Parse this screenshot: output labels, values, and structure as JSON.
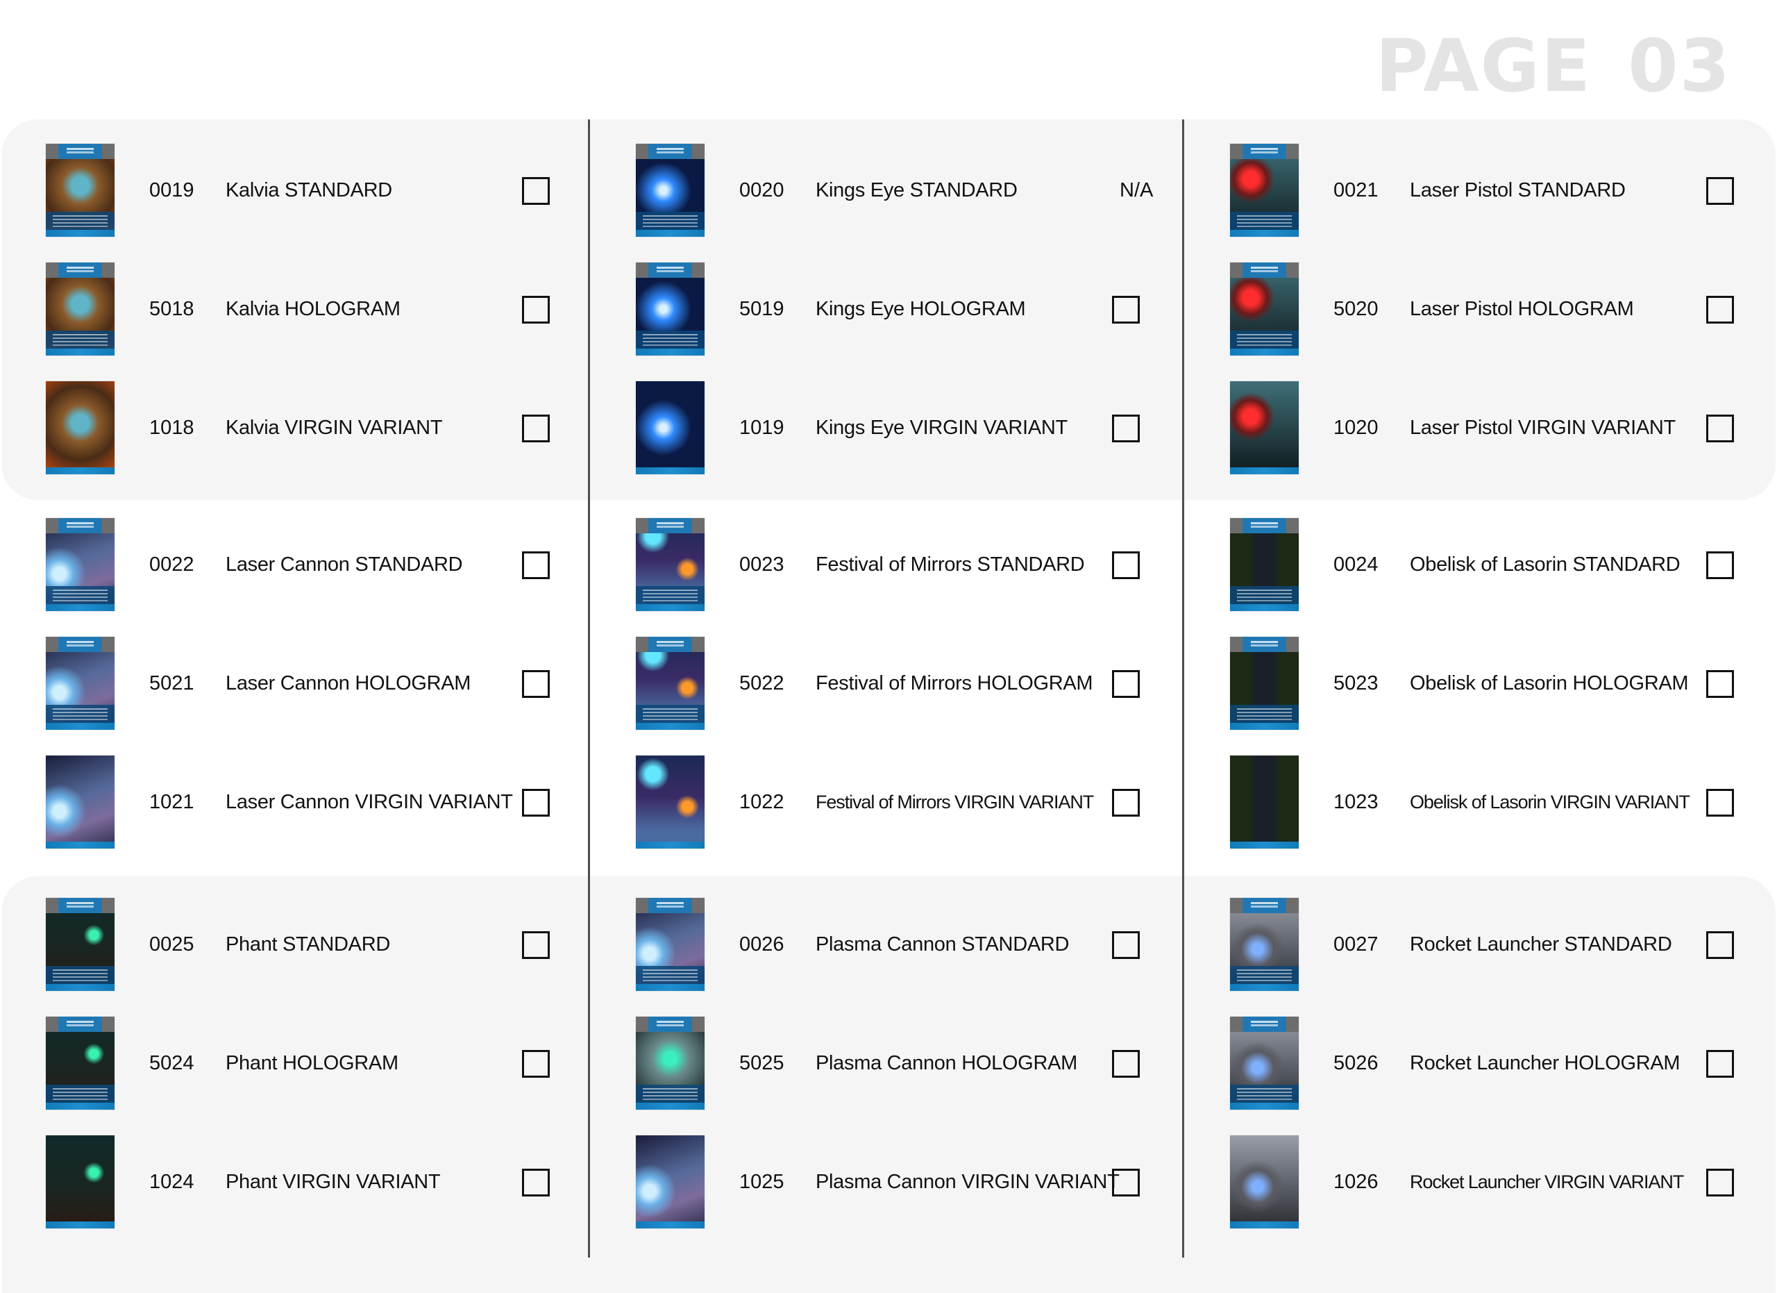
{
  "page": {
    "title": "PAGE 03"
  },
  "colors": {
    "title": "#e4e4e4",
    "band_shaded": "#f5f5f5",
    "divider": "#4d4d4d",
    "card_blue": "#1f78b4"
  },
  "groups": [
    {
      "columns": [
        {
          "entries": [
            {
              "code": "0019",
              "name": "Kalvia STANDARD",
              "status": "checkbox",
              "checked": false,
              "art": "kalvia"
            },
            {
              "code": "5018",
              "name": "Kalvia HOLOGRAM",
              "status": "checkbox",
              "checked": false,
              "art": "kalvia"
            },
            {
              "code": "1018",
              "name": "Kalvia VIRGIN VARIANT",
              "status": "checkbox",
              "checked": false,
              "art": "kalvia",
              "virgin": true
            }
          ]
        },
        {
          "entries": [
            {
              "code": "0020",
              "name": "Kings Eye STANDARD",
              "status": "N/A",
              "art": "kings-eye"
            },
            {
              "code": "5019",
              "name": "Kings Eye HOLOGRAM",
              "status": "checkbox",
              "checked": false,
              "art": "kings-eye"
            },
            {
              "code": "1019",
              "name": "Kings Eye VIRGIN VARIANT",
              "status": "checkbox",
              "checked": false,
              "art": "kings-eye",
              "virgin": true
            }
          ]
        },
        {
          "entries": [
            {
              "code": "0021",
              "name": "Laser Pistol STANDARD",
              "status": "checkbox",
              "checked": false,
              "art": "laser-pistol"
            },
            {
              "code": "5020",
              "name": "Laser Pistol HOLOGRAM",
              "status": "checkbox",
              "checked": false,
              "art": "laser-pistol"
            },
            {
              "code": "1020",
              "name": "Laser Pistol VIRGIN VARIANT",
              "status": "checkbox",
              "checked": false,
              "art": "laser-pistol",
              "virgin": true
            }
          ]
        }
      ]
    },
    {
      "columns": [
        {
          "entries": [
            {
              "code": "0022",
              "name": "Laser Cannon STANDARD",
              "status": "checkbox",
              "checked": false,
              "art": "laser-cannon"
            },
            {
              "code": "5021",
              "name": "Laser Cannon HOLOGRAM",
              "status": "checkbox",
              "checked": false,
              "art": "laser-cannon"
            },
            {
              "code": "1021",
              "name": "Laser Cannon VIRGIN VARIANT",
              "status": "checkbox",
              "checked": false,
              "art": "laser-cannon",
              "virgin": true
            }
          ]
        },
        {
          "entries": [
            {
              "code": "0023",
              "name": "Festival of Mirrors STANDARD",
              "status": "checkbox",
              "checked": false,
              "art": "festival"
            },
            {
              "code": "5022",
              "name": "Festival of Mirrors HOLOGRAM",
              "status": "checkbox",
              "checked": false,
              "art": "festival"
            },
            {
              "code": "1022",
              "name": "Festival of Mirrors VIRGIN VARIANT",
              "status": "checkbox",
              "checked": false,
              "art": "festival",
              "virgin": true
            }
          ]
        },
        {
          "entries": [
            {
              "code": "0024",
              "name": "Obelisk of Lasorin STANDARD",
              "status": "checkbox",
              "checked": false,
              "art": "obelisk"
            },
            {
              "code": "5023",
              "name": "Obelisk of Lasorin HOLOGRAM",
              "status": "checkbox",
              "checked": false,
              "art": "obelisk"
            },
            {
              "code": "1023",
              "name": "Obelisk of Lasorin VIRGIN VARIANT",
              "status": "checkbox",
              "checked": false,
              "art": "obelisk",
              "virgin": true
            }
          ]
        }
      ]
    },
    {
      "columns": [
        {
          "entries": [
            {
              "code": "0025",
              "name": "Phant STANDARD",
              "status": "checkbox",
              "checked": false,
              "art": "phant"
            },
            {
              "code": "5024",
              "name": "Phant HOLOGRAM",
              "status": "checkbox",
              "checked": false,
              "art": "phant"
            },
            {
              "code": "1024",
              "name": "Phant VIRGIN VARIANT",
              "status": "checkbox",
              "checked": false,
              "art": "phant",
              "virgin": true
            }
          ]
        },
        {
          "entries": [
            {
              "code": "0026",
              "name": "Plasma Cannon STANDARD",
              "status": "checkbox",
              "checked": false,
              "art": "laser-cannon"
            },
            {
              "code": "5025",
              "name": "Plasma Cannon HOLOGRAM",
              "status": "checkbox",
              "checked": false,
              "art": "bender-shield"
            },
            {
              "code": "1025",
              "name": "Plasma Cannon VIRGIN VARIANT",
              "status": "checkbox",
              "checked": false,
              "art": "laser-cannon",
              "virgin": true
            }
          ]
        },
        {
          "entries": [
            {
              "code": "0027",
              "name": "Rocket Launcher STANDARD",
              "status": "checkbox",
              "checked": false,
              "art": "rocket-launcher"
            },
            {
              "code": "5026",
              "name": "Rocket Launcher HOLOGRAM",
              "status": "checkbox",
              "checked": false,
              "art": "rocket-launcher"
            },
            {
              "code": "1026",
              "name": "Rocket Launcher VIRGIN VARIANT",
              "status": "checkbox",
              "checked": false,
              "art": "rocket-launcher",
              "virgin": true
            }
          ]
        }
      ]
    }
  ]
}
